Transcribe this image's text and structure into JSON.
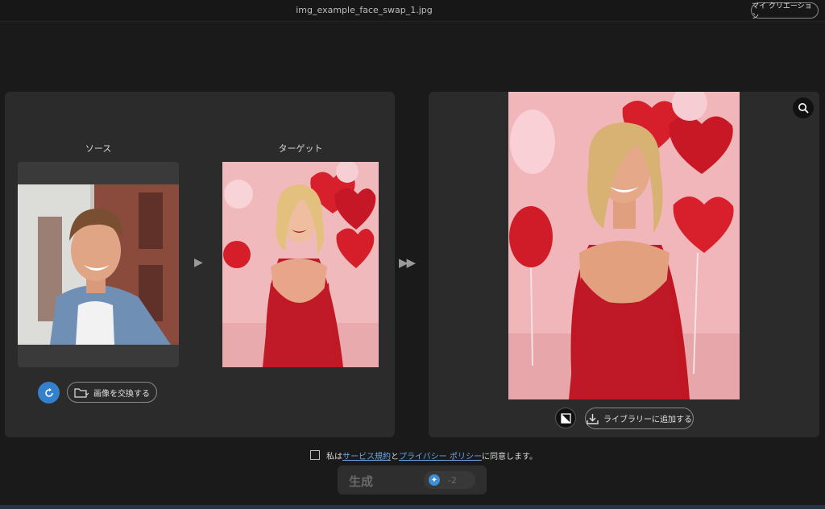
{
  "window": {
    "filename": "img_example_face_swap_1.jpg",
    "my_creation_label": "マイ クリエーション"
  },
  "source": {
    "label": "ソース",
    "swap_button_label": "画像を交換する"
  },
  "target": {
    "label": "ターゲット"
  },
  "result": {
    "add_to_library_label": "ライブラリーに追加する"
  },
  "agreement": {
    "prefix": "私は",
    "terms_link": "サービス規約",
    "conjunction": "と",
    "privacy_link": "プライバシー ポリシー",
    "suffix": "に同意します。"
  },
  "generate": {
    "label": "生成",
    "credit_cost": "-2"
  },
  "colors": {
    "accent": "#3580cc",
    "link": "#6aa8e8",
    "panel": "#2b2b2b",
    "background": "#1a1a1a"
  }
}
